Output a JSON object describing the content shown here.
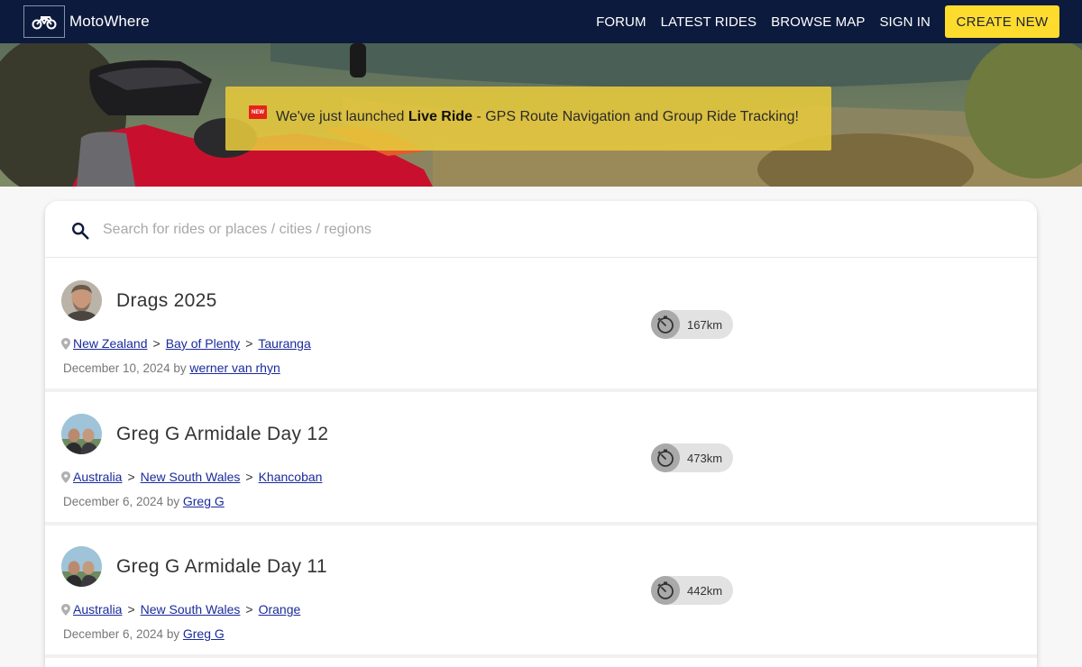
{
  "brand": {
    "name": "MotoWhere",
    "icon": "motorcycle-icon"
  },
  "nav": [
    {
      "label": "FORUM"
    },
    {
      "label": "LATEST RIDES"
    },
    {
      "label": "BROWSE MAP"
    },
    {
      "label": "SIGN IN"
    }
  ],
  "create_button": "CREATE NEW",
  "banner": {
    "badge": "NEW",
    "text_before": "We've just launched ",
    "text_bold": "Live Ride",
    "text_after": " - GPS Route Navigation and Group Ride Tracking!"
  },
  "search": {
    "placeholder": "Search for rides or places / cities / regions",
    "value": ""
  },
  "rides": [
    {
      "title": "Drags 2025",
      "crumbs": [
        "New Zealand",
        "Bay of Plenty",
        "Tauranga"
      ],
      "date": "December 10, 2024",
      "by": "by",
      "author": "werner van rhyn",
      "distance": "167km"
    },
    {
      "title": "Greg G Armidale Day 12",
      "crumbs": [
        "Australia",
        "New South Wales",
        "Khancoban"
      ],
      "date": "December 6, 2024",
      "by": "by",
      "author": "Greg G",
      "distance": "473km"
    },
    {
      "title": "Greg G Armidale Day 11",
      "crumbs": [
        "Australia",
        "New South Wales",
        "Orange"
      ],
      "date": "December 6, 2024",
      "by": "by",
      "author": "Greg G",
      "distance": "442km"
    }
  ],
  "colors": {
    "navbar": "#0c1a3d",
    "accent": "#fddc2e",
    "link": "#1a2b9b",
    "banner": "#e6c83c"
  }
}
